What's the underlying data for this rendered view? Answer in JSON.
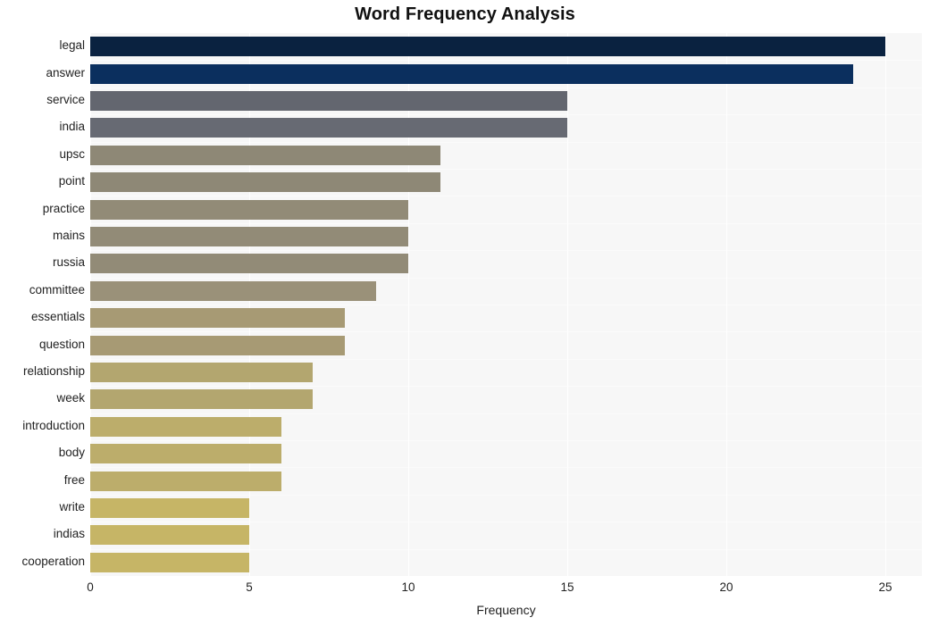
{
  "chart_data": {
    "type": "bar",
    "orientation": "horizontal",
    "title": "Word Frequency Analysis",
    "xlabel": "Frequency",
    "ylabel": "",
    "xlim": [
      0,
      26.15
    ],
    "xticks": [
      0,
      5,
      10,
      15,
      20,
      25
    ],
    "xtick_labels": [
      "0",
      "5",
      "10",
      "15",
      "20",
      "25"
    ],
    "grid": true,
    "grid_axis": "x",
    "legend": false,
    "plot_background": "#f7f7f7",
    "figure_background": "#ffffff",
    "categories": [
      "legal",
      "answer",
      "service",
      "india",
      "upsc",
      "point",
      "practice",
      "mains",
      "russia",
      "committee",
      "essentials",
      "question",
      "relationship",
      "week",
      "introduction",
      "body",
      "free",
      "write",
      "indias",
      "cooperation"
    ],
    "values": [
      25,
      24,
      15,
      15,
      11,
      11,
      10,
      10,
      10,
      9,
      8,
      8,
      7,
      7,
      6,
      6,
      6,
      5,
      5,
      5
    ],
    "bar_colors": [
      "#0a2240",
      "#0b2f5e",
      "#63666f",
      "#676a73",
      "#8e8876",
      "#8e8876",
      "#928b77",
      "#928b77",
      "#928b77",
      "#9a9179",
      "#a79a74",
      "#a79a74",
      "#b3a66f",
      "#b3a66f",
      "#bcad6b",
      "#bcad6b",
      "#bcad6b",
      "#c6b566",
      "#c6b566",
      "#c6b566"
    ]
  }
}
